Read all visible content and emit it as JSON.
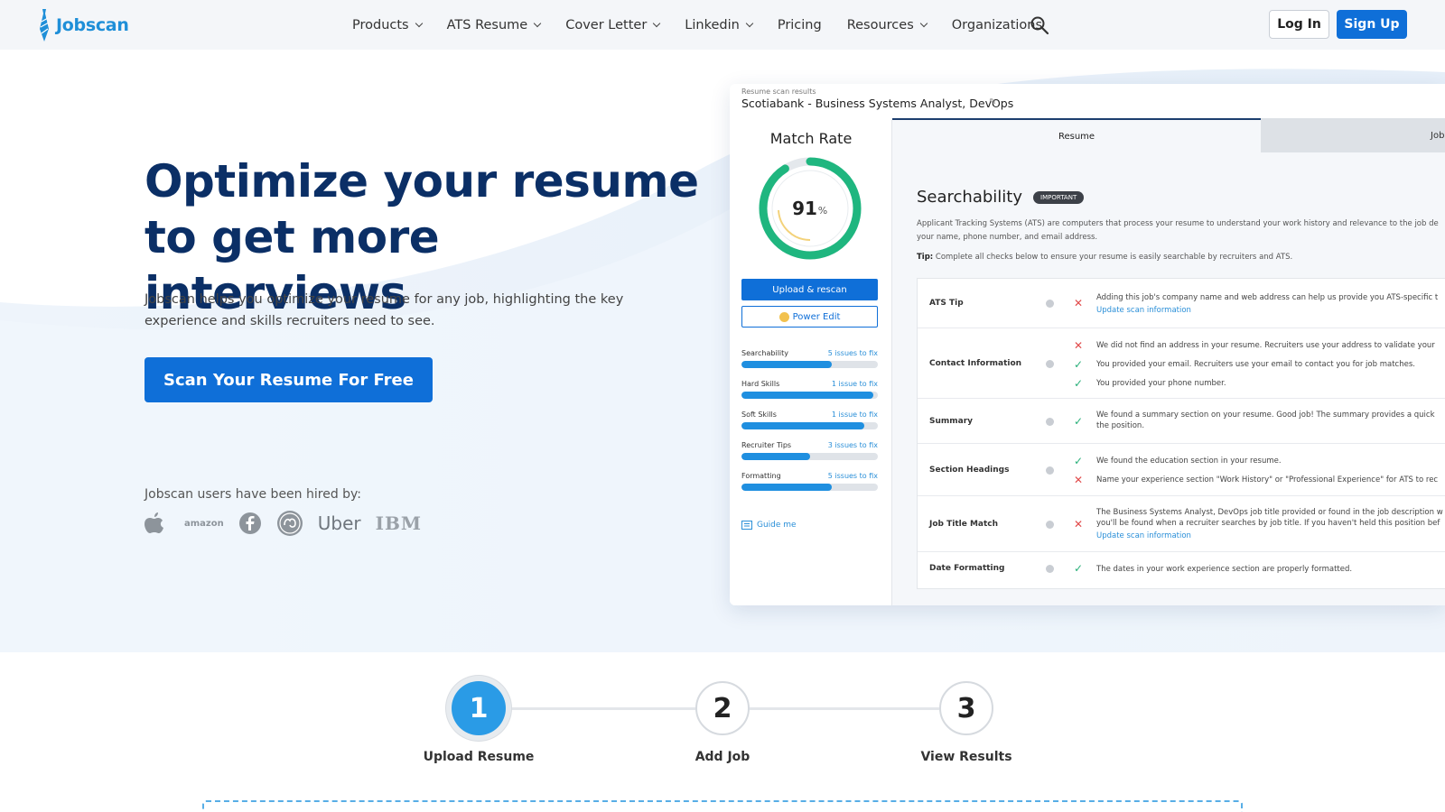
{
  "nav": {
    "brand": "Jobscan",
    "menu": [
      {
        "label": "Products",
        "dropdown": true
      },
      {
        "label": "ATS Resume",
        "dropdown": true
      },
      {
        "label": "Cover Letter",
        "dropdown": true
      },
      {
        "label": "Linkedin",
        "dropdown": true
      },
      {
        "label": "Pricing",
        "dropdown": false
      },
      {
        "label": "Resources",
        "dropdown": true
      },
      {
        "label": "Organizations",
        "dropdown": false
      }
    ],
    "login": "Log In",
    "signup": "Sign Up"
  },
  "hero": {
    "headline_line1": "Optimize your resume",
    "headline_line2": "to get more interviews",
    "subtext": "Jobscan helps you optimize your resume for any job, highlighting the key experience and skills recruiters need to see.",
    "cta": "Scan Your Resume For Free",
    "hired_by": "Jobscan users have been hired by:",
    "companies": [
      "amazon",
      "Uber",
      "IBM"
    ]
  },
  "mock": {
    "small_label": "Resume scan results",
    "title": "Scotiabank - Business Systems Analyst, DevOps",
    "match_rate_title": "Match Rate",
    "match_value": "91",
    "match_unit": "%",
    "match_fraction": 0.91,
    "upload_rescan": "Upload & rescan",
    "power_edit": "Power Edit",
    "progress": [
      {
        "label": "Searchability",
        "fix": "5 issues to fix",
        "fraction": 0.66
      },
      {
        "label": "Hard Skills",
        "fix": "1 issue to fix",
        "fraction": 0.97
      },
      {
        "label": "Soft Skills",
        "fix": "1 issue to fix",
        "fraction": 0.9
      },
      {
        "label": "Recruiter Tips",
        "fix": "3 issues to fix",
        "fraction": 0.5
      },
      {
        "label": "Formatting",
        "fix": "5 issues to fix",
        "fraction": 0.66
      }
    ],
    "guide_me": "Guide me",
    "tab_resume": "Resume",
    "tab_job": "Job",
    "section_title": "Searchability",
    "badge": "IMPORTANT",
    "desc_line1": "Applicant Tracking Systems (ATS) are computers that process your resume to understand your work history and relevance to the job de",
    "desc_line2": "your name, phone number, and email address.",
    "tip_label": "Tip:",
    "tip_text": "Complete all checks below to ensure your resume is easily searchable by recruiters and ATS.",
    "rows": [
      {
        "label": "ATS Tip",
        "items": [
          {
            "status": "bad",
            "text": "Adding this job's company name and web address can help us provide you ATS-specific t",
            "link": "Update scan information"
          }
        ]
      },
      {
        "label": "Contact Information",
        "items": [
          {
            "status": "bad",
            "text": "We did not find an address in your resume. Recruiters use your address to validate your"
          },
          {
            "status": "ok",
            "text": "You provided your email. Recruiters use your email to contact you for job matches."
          },
          {
            "status": "ok",
            "text": "You provided your phone number."
          }
        ]
      },
      {
        "label": "Summary",
        "items": [
          {
            "status": "ok",
            "text": "We found a summary section on your resume. Good job! The summary provides a quick",
            "text2": "the position."
          }
        ]
      },
      {
        "label": "Section Headings",
        "items": [
          {
            "status": "ok",
            "text": "We found the education section in your resume."
          },
          {
            "status": "bad",
            "text": "Name your experience section \"Work History\" or \"Professional Experience\" for ATS to rec"
          }
        ]
      },
      {
        "label": "Job Title Match",
        "items": [
          {
            "status": "bad",
            "text": "The Business Systems Analyst, DevOps job title provided or found in the job description w",
            "text2": "you'll be found when a recruiter searches by job title. If you haven't held this position bef",
            "link": "Update scan information"
          }
        ]
      },
      {
        "label": "Date Formatting",
        "items": [
          {
            "status": "ok",
            "text": "The dates in your work experience section are properly formatted."
          }
        ]
      }
    ]
  },
  "steps": [
    {
      "number": "1",
      "label": "Upload Resume",
      "active": true
    },
    {
      "number": "2",
      "label": "Add Job",
      "active": false
    },
    {
      "number": "3",
      "label": "View Results",
      "active": false
    }
  ],
  "colors": {
    "primary": "#0f6fd8",
    "heading": "#0b2f66",
    "brand": "#1f8fd8",
    "ok": "#2ab07a",
    "bad": "#e14b4b"
  }
}
